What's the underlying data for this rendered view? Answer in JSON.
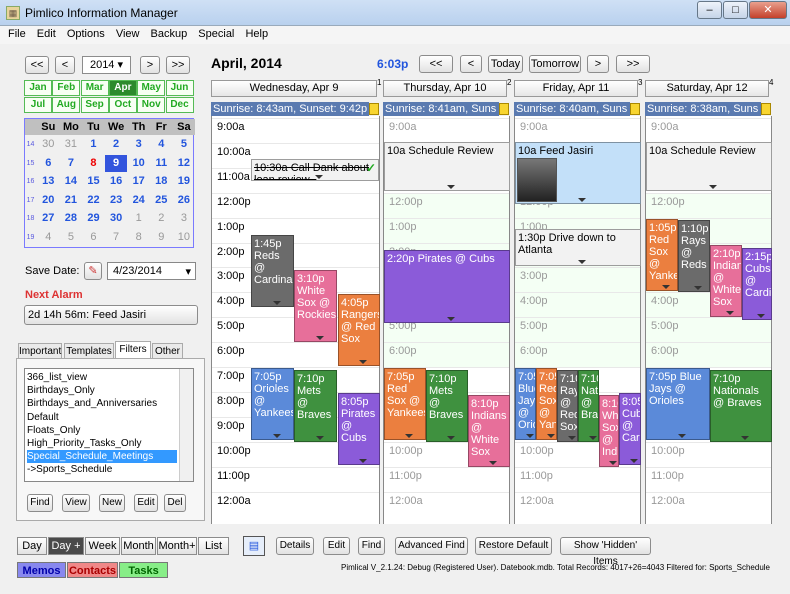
{
  "window": {
    "title": "Pimlico Information Manager",
    "min": "–",
    "max": "□",
    "close": "✕",
    "app_icon": "calendar-icon"
  },
  "menu": [
    "File",
    "Edit",
    "Options",
    "View",
    "Backup",
    "Special",
    "Help"
  ],
  "nav": {
    "prev_year": "<<",
    "prev": "<",
    "year": "2014",
    "next": ">",
    "next_year": ">>"
  },
  "months": [
    "Jan",
    "Feb",
    "Mar",
    "Apr",
    "May",
    "Jun",
    "Jul",
    "Aug",
    "Sep",
    "Oct",
    "Nov",
    "Dec"
  ],
  "calendar": {
    "headers": [
      "Su",
      "Mo",
      "Tu",
      "We",
      "Th",
      "Fr",
      "Sa"
    ],
    "weeks": [
      {
        "wk": "14",
        "days": [
          "30",
          "31",
          "1",
          "2",
          "3",
          "4",
          "5"
        ]
      },
      {
        "wk": "15",
        "days": [
          "6",
          "7",
          "8",
          "9",
          "10",
          "11",
          "12"
        ]
      },
      {
        "wk": "16",
        "days": [
          "13",
          "14",
          "15",
          "16",
          "17",
          "18",
          "19"
        ]
      },
      {
        "wk": "17",
        "days": [
          "20",
          "21",
          "22",
          "23",
          "24",
          "25",
          "26"
        ]
      },
      {
        "wk": "18",
        "days": [
          "27",
          "28",
          "29",
          "30",
          "1",
          "2",
          "3"
        ]
      },
      {
        "wk": "19",
        "days": [
          "4",
          "5",
          "6",
          "7",
          "8",
          "9",
          "10"
        ]
      }
    ]
  },
  "save_date": {
    "label": "Save Date:",
    "value": "4/23/2014"
  },
  "alarm": {
    "label": "Next Alarm",
    "value": "2d 14h 56m:  Feed Jasiri"
  },
  "tabs": [
    "Important",
    "Templates",
    "Filters",
    "Other"
  ],
  "filters": [
    "366_list_view",
    "Birthdays_Only",
    "Birthdays_and_Anniversaries",
    "Default",
    "Floats_Only",
    "High_Priority_Tasks_Only",
    "Special_Schedule_Meetings",
    "->Sports_Schedule"
  ],
  "filter_buttons": [
    "Find",
    "View",
    "New",
    "Edit",
    "Del"
  ],
  "header": {
    "month": "April, 2014",
    "time": "6:03p",
    "today": "Today",
    "tomorrow": "Tomorrow",
    "prev2": "<<",
    "prev1": "<",
    "next1": ">",
    "next2": ">>"
  },
  "days": [
    {
      "name": "Wednesday, Apr 9",
      "num": "1",
      "sun": "Sunrise: 8:43am, Sunset: 9:42p"
    },
    {
      "name": "Thursday, Apr 10",
      "num": "2",
      "sun": "Sunrise: 8:41am, Suns"
    },
    {
      "name": "Friday, Apr 11",
      "num": "3",
      "sun": "Sunrise: 8:40am, Suns"
    },
    {
      "name": "Saturday, Apr 12",
      "num": "4",
      "sun": "Sunrise: 8:38am, Suns"
    }
  ],
  "hours": [
    "9:00a",
    "10:00a",
    "11:00a",
    "12:00p",
    "1:00p",
    "2:00p",
    "3:00p",
    "4:00p",
    "5:00p",
    "6:00p",
    "7:00p",
    "8:00p",
    "9:00p",
    "10:00p",
    "11:00p",
    "12:00a"
  ],
  "events": {
    "wed": [
      "10:30a Call Dank about loan review -",
      "1:45p Reds @ Cardinals",
      "3:10p White Sox @ Rockies",
      "4:05p Rangers @ Red Sox",
      "7:05p Orioles @ Yankees",
      "7:10p Mets @ Braves",
      "8:05p Pirates @ Cubs"
    ],
    "thu": [
      "10a Schedule Review",
      "2:20p Pirates @ Cubs",
      "7:05p Red Sox @ Yankees",
      "7:10p Mets @ Braves",
      "8:10p Indians @ White Sox"
    ],
    "fri": [
      "10a Feed Jasiri",
      "1:30p Drive down to Atlanta",
      "7:05p Blue Jays @ Orioles",
      "7:05p Red Sox @ Yankees",
      "7:10p Rays @ Red Sox",
      "7:10p Nationals @ Braves",
      "8:10p White Sox @ Indians",
      "8:05p Cubs @ Cardinals"
    ],
    "sat": [
      "10a Schedule Review",
      "1:05p Red Sox @ Yankees",
      "1:10p Rays @ Reds",
      "2:10p Indians @ White Sox",
      "2:15p Cubs @ Cardinals",
      "7:05p Blue Jays @ Orioles",
      "7:10p Nationals @ Braves"
    ]
  },
  "bottom_buttons": [
    "Details",
    "Edit",
    "Find",
    "Advanced Find",
    "Restore Default",
    "Show 'Hidden' Items"
  ],
  "views": [
    "Day",
    "Day +",
    "Week",
    "Month",
    "Month+",
    "List"
  ],
  "modules": [
    "Memos",
    "Contacts",
    "Tasks"
  ],
  "status": "Pimlical V_2.1.24: Debug (Registered User). Datebook.mdb. Total Records: 4017+26=4043 Filtered for: Sports_Schedule"
}
